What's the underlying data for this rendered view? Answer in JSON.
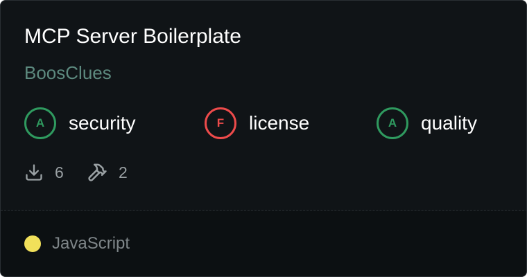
{
  "card": {
    "title": "MCP Server Boilerplate",
    "author": "BoosClues"
  },
  "scores": [
    {
      "grade": "A",
      "label": "security",
      "status": "good"
    },
    {
      "grade": "F",
      "label": "license",
      "status": "bad"
    },
    {
      "grade": "A",
      "label": "quality",
      "status": "good"
    }
  ],
  "stats": {
    "downloads": {
      "icon": "download-icon",
      "value": "6"
    },
    "tools": {
      "icon": "hammer-icon",
      "value": "2"
    }
  },
  "language": {
    "name": "JavaScript",
    "color": "#f1e05a"
  },
  "colors": {
    "grade_good": "#2f9a5f",
    "grade_bad": "#ee4b4b",
    "author": "#5d8a7f"
  }
}
